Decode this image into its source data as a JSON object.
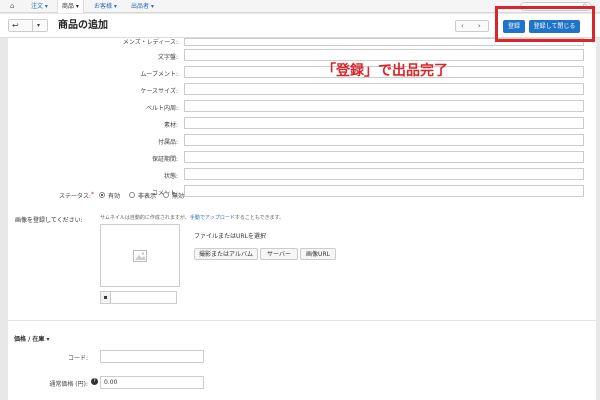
{
  "topnav": {
    "items": [
      {
        "label": "注文 ▾"
      },
      {
        "label": "商品 ▾"
      },
      {
        "label": "お客様 ▾"
      },
      {
        "label": "出品者 ▾"
      }
    ],
    "search_icon": "magnifier-icon",
    "search_glyph": "⚲"
  },
  "header": {
    "back_glyph": "↩",
    "caret_glyph": "▾",
    "title": "商品の追加",
    "prev_glyph": "‹",
    "next_glyph": "›",
    "register_label": "登録",
    "register_close_label": "登録して閉じる"
  },
  "annotation": {
    "callout": "「登録」で出品完了",
    "color": "#d9262b"
  },
  "form": {
    "fields": [
      {
        "label": "メンズ・レディース:"
      },
      {
        "label": "文字盤:"
      },
      {
        "label": "ムーブメント:"
      },
      {
        "label": "ケースサイズ:"
      },
      {
        "label": "ベルト内周:"
      },
      {
        "label": "素材:"
      },
      {
        "label": "付属品:"
      },
      {
        "label": "保証期間:"
      },
      {
        "label": "状態:"
      },
      {
        "label": "コメント:"
      }
    ],
    "status": {
      "label": "ステータス:",
      "required_mark": "*",
      "options": [
        "有効",
        "非表示",
        "無効"
      ],
      "selected": "有効"
    },
    "images": {
      "label": "画像を登録してください:",
      "help_prefix": "サムネイルは自動的に作成されますが、",
      "help_link": "手動でアップロード",
      "help_suffix": "することもできます。",
      "file_label": "ファイルまたはURLを選択",
      "buttons": [
        "撮影またはアルバム",
        "サーバー",
        "画像URL"
      ]
    }
  },
  "price_section": {
    "heading": "価格 / 在庫 ▾",
    "code_label": "コード:",
    "price_label": "通常価格 (円):",
    "price_value": "0.00"
  }
}
